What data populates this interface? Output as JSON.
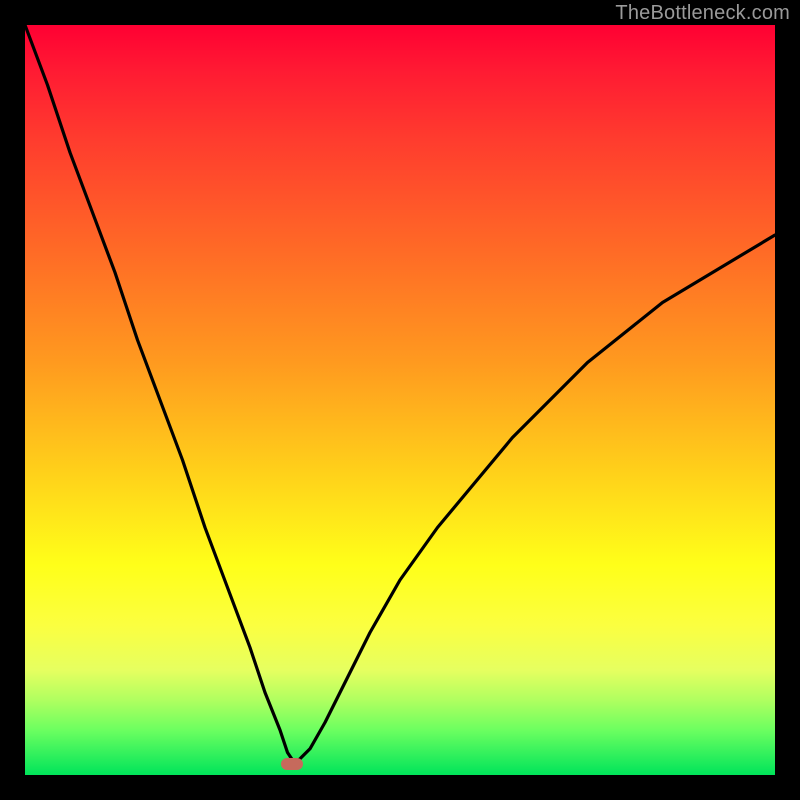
{
  "watermark": "TheBottleneck.com",
  "chart_data": {
    "type": "line",
    "title": "",
    "xlabel": "",
    "ylabel": "",
    "xlim": [
      0,
      1
    ],
    "ylim": [
      0,
      1
    ],
    "x": [
      0.0,
      0.03,
      0.06,
      0.09,
      0.12,
      0.15,
      0.18,
      0.21,
      0.24,
      0.27,
      0.3,
      0.32,
      0.34,
      0.35,
      0.36,
      0.38,
      0.4,
      0.43,
      0.46,
      0.5,
      0.55,
      0.6,
      0.65,
      0.7,
      0.75,
      0.8,
      0.85,
      0.9,
      0.95,
      1.0
    ],
    "values": [
      1.0,
      0.92,
      0.83,
      0.75,
      0.67,
      0.58,
      0.5,
      0.42,
      0.33,
      0.25,
      0.17,
      0.11,
      0.06,
      0.03,
      0.015,
      0.035,
      0.07,
      0.13,
      0.19,
      0.26,
      0.33,
      0.39,
      0.45,
      0.5,
      0.55,
      0.59,
      0.63,
      0.66,
      0.69,
      0.72
    ],
    "minimum_x": 0.36,
    "gradient_stops": [
      {
        "pos": 0.0,
        "meaning": "worst",
        "color": "#ff0033"
      },
      {
        "pos": 0.5,
        "meaning": "mid",
        "color": "#ffd21a"
      },
      {
        "pos": 1.0,
        "meaning": "best",
        "color": "#00e45a"
      }
    ]
  },
  "marker": {
    "x_frac": 0.356,
    "y_frac": 0.985
  }
}
